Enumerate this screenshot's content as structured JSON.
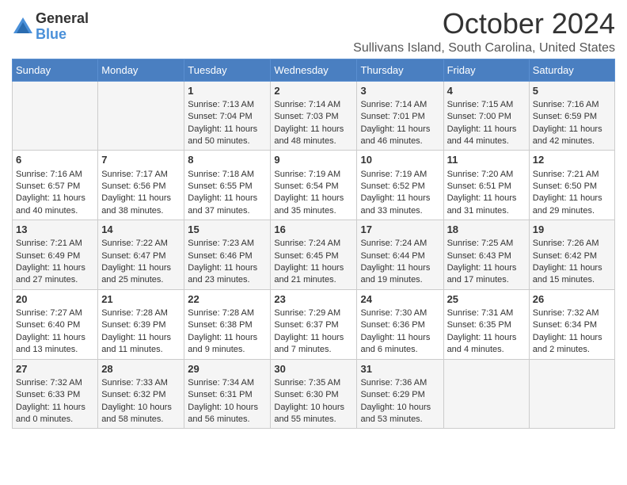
{
  "logo": {
    "general": "General",
    "blue": "Blue"
  },
  "title": "October 2024",
  "subtitle": "Sullivans Island, South Carolina, United States",
  "days_of_week": [
    "Sunday",
    "Monday",
    "Tuesday",
    "Wednesday",
    "Thursday",
    "Friday",
    "Saturday"
  ],
  "weeks": [
    [
      {
        "day": "",
        "content": ""
      },
      {
        "day": "",
        "content": ""
      },
      {
        "day": "1",
        "content": "Sunrise: 7:13 AM\nSunset: 7:04 PM\nDaylight: 11 hours\nand 50 minutes."
      },
      {
        "day": "2",
        "content": "Sunrise: 7:14 AM\nSunset: 7:03 PM\nDaylight: 11 hours\nand 48 minutes."
      },
      {
        "day": "3",
        "content": "Sunrise: 7:14 AM\nSunset: 7:01 PM\nDaylight: 11 hours\nand 46 minutes."
      },
      {
        "day": "4",
        "content": "Sunrise: 7:15 AM\nSunset: 7:00 PM\nDaylight: 11 hours\nand 44 minutes."
      },
      {
        "day": "5",
        "content": "Sunrise: 7:16 AM\nSunset: 6:59 PM\nDaylight: 11 hours\nand 42 minutes."
      }
    ],
    [
      {
        "day": "6",
        "content": "Sunrise: 7:16 AM\nSunset: 6:57 PM\nDaylight: 11 hours\nand 40 minutes."
      },
      {
        "day": "7",
        "content": "Sunrise: 7:17 AM\nSunset: 6:56 PM\nDaylight: 11 hours\nand 38 minutes."
      },
      {
        "day": "8",
        "content": "Sunrise: 7:18 AM\nSunset: 6:55 PM\nDaylight: 11 hours\nand 37 minutes."
      },
      {
        "day": "9",
        "content": "Sunrise: 7:19 AM\nSunset: 6:54 PM\nDaylight: 11 hours\nand 35 minutes."
      },
      {
        "day": "10",
        "content": "Sunrise: 7:19 AM\nSunset: 6:52 PM\nDaylight: 11 hours\nand 33 minutes."
      },
      {
        "day": "11",
        "content": "Sunrise: 7:20 AM\nSunset: 6:51 PM\nDaylight: 11 hours\nand 31 minutes."
      },
      {
        "day": "12",
        "content": "Sunrise: 7:21 AM\nSunset: 6:50 PM\nDaylight: 11 hours\nand 29 minutes."
      }
    ],
    [
      {
        "day": "13",
        "content": "Sunrise: 7:21 AM\nSunset: 6:49 PM\nDaylight: 11 hours\nand 27 minutes."
      },
      {
        "day": "14",
        "content": "Sunrise: 7:22 AM\nSunset: 6:47 PM\nDaylight: 11 hours\nand 25 minutes."
      },
      {
        "day": "15",
        "content": "Sunrise: 7:23 AM\nSunset: 6:46 PM\nDaylight: 11 hours\nand 23 minutes."
      },
      {
        "day": "16",
        "content": "Sunrise: 7:24 AM\nSunset: 6:45 PM\nDaylight: 11 hours\nand 21 minutes."
      },
      {
        "day": "17",
        "content": "Sunrise: 7:24 AM\nSunset: 6:44 PM\nDaylight: 11 hours\nand 19 minutes."
      },
      {
        "day": "18",
        "content": "Sunrise: 7:25 AM\nSunset: 6:43 PM\nDaylight: 11 hours\nand 17 minutes."
      },
      {
        "day": "19",
        "content": "Sunrise: 7:26 AM\nSunset: 6:42 PM\nDaylight: 11 hours\nand 15 minutes."
      }
    ],
    [
      {
        "day": "20",
        "content": "Sunrise: 7:27 AM\nSunset: 6:40 PM\nDaylight: 11 hours\nand 13 minutes."
      },
      {
        "day": "21",
        "content": "Sunrise: 7:28 AM\nSunset: 6:39 PM\nDaylight: 11 hours\nand 11 minutes."
      },
      {
        "day": "22",
        "content": "Sunrise: 7:28 AM\nSunset: 6:38 PM\nDaylight: 11 hours\nand 9 minutes."
      },
      {
        "day": "23",
        "content": "Sunrise: 7:29 AM\nSunset: 6:37 PM\nDaylight: 11 hours\nand 7 minutes."
      },
      {
        "day": "24",
        "content": "Sunrise: 7:30 AM\nSunset: 6:36 PM\nDaylight: 11 hours\nand 6 minutes."
      },
      {
        "day": "25",
        "content": "Sunrise: 7:31 AM\nSunset: 6:35 PM\nDaylight: 11 hours\nand 4 minutes."
      },
      {
        "day": "26",
        "content": "Sunrise: 7:32 AM\nSunset: 6:34 PM\nDaylight: 11 hours\nand 2 minutes."
      }
    ],
    [
      {
        "day": "27",
        "content": "Sunrise: 7:32 AM\nSunset: 6:33 PM\nDaylight: 11 hours\nand 0 minutes."
      },
      {
        "day": "28",
        "content": "Sunrise: 7:33 AM\nSunset: 6:32 PM\nDaylight: 10 hours\nand 58 minutes."
      },
      {
        "day": "29",
        "content": "Sunrise: 7:34 AM\nSunset: 6:31 PM\nDaylight: 10 hours\nand 56 minutes."
      },
      {
        "day": "30",
        "content": "Sunrise: 7:35 AM\nSunset: 6:30 PM\nDaylight: 10 hours\nand 55 minutes."
      },
      {
        "day": "31",
        "content": "Sunrise: 7:36 AM\nSunset: 6:29 PM\nDaylight: 10 hours\nand 53 minutes."
      },
      {
        "day": "",
        "content": ""
      },
      {
        "day": "",
        "content": ""
      }
    ]
  ]
}
